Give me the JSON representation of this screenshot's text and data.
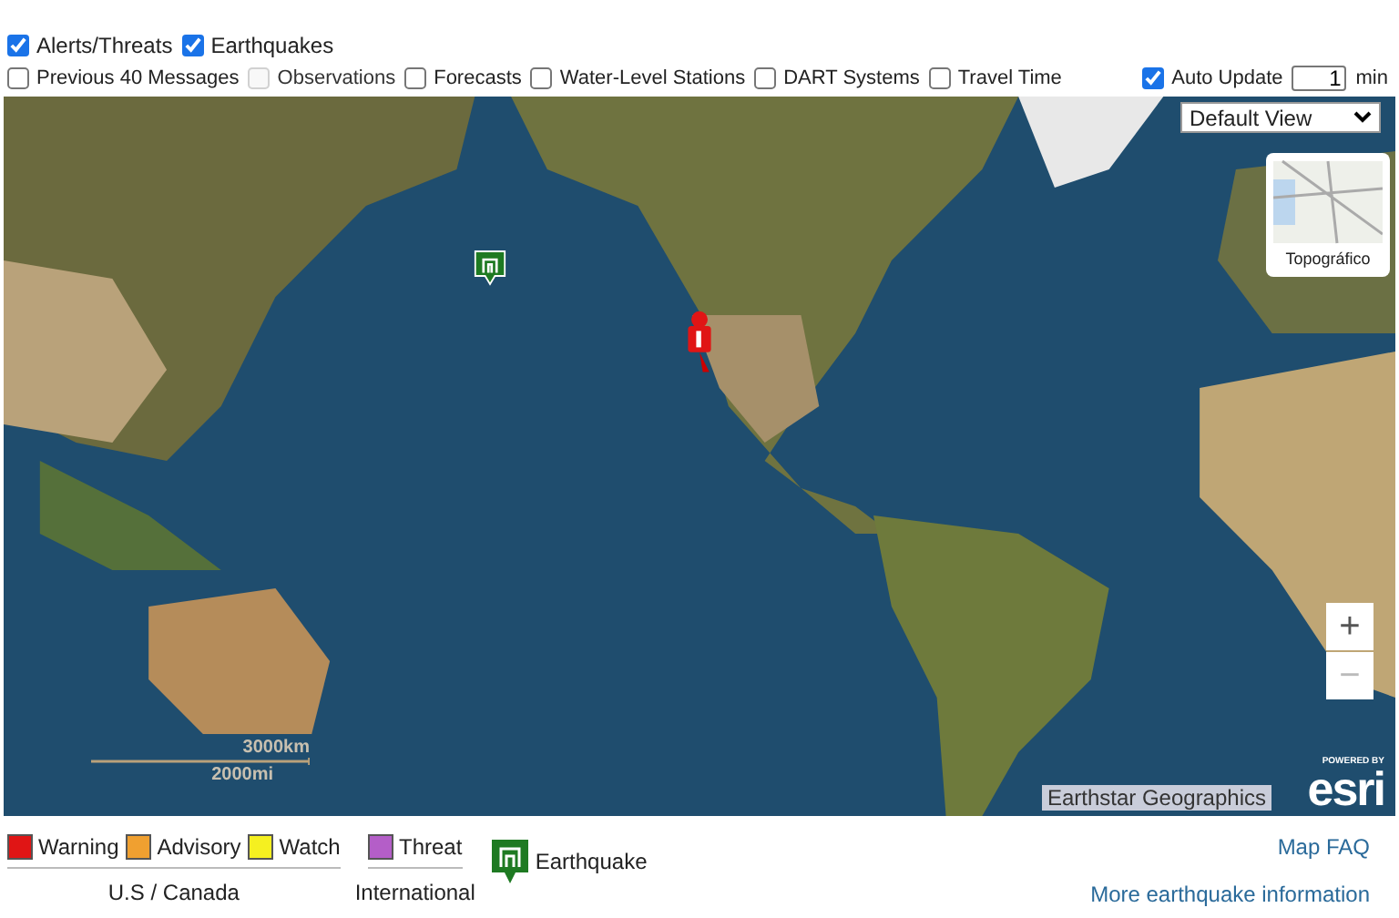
{
  "filters_top": [
    {
      "label": "Alerts/Threats",
      "checked": true,
      "disabled": false
    },
    {
      "label": "Earthquakes",
      "checked": true,
      "disabled": false
    }
  ],
  "filters": [
    {
      "label": "Previous 40 Messages",
      "checked": false,
      "disabled": false
    },
    {
      "label": "Observations",
      "checked": false,
      "disabled": true
    },
    {
      "label": "Forecasts",
      "checked": false,
      "disabled": false
    },
    {
      "label": "Water-Level Stations",
      "checked": false,
      "disabled": false
    },
    {
      "label": "DART Systems",
      "checked": false,
      "disabled": false
    },
    {
      "label": "Travel Time",
      "checked": false,
      "disabled": false
    }
  ],
  "auto_update": {
    "label": "Auto Update",
    "checked": true,
    "value": "1",
    "unit": "min"
  },
  "map": {
    "view_select": "Default View",
    "basemap_label": "Topográfico",
    "scale": [
      "3000km",
      "2000mi"
    ],
    "attribution": "Earthstar Geographics",
    "powered_by": "POWERED BY",
    "logo": "esri",
    "zoom_buttons": [
      "+",
      "−"
    ]
  },
  "legend": {
    "groups": [
      {
        "caption": "U.S / Canada",
        "items": [
          {
            "label": "Warning",
            "color": "#e01515"
          },
          {
            "label": "Advisory",
            "color": "#f0a030"
          },
          {
            "label": "Watch",
            "color": "#f5f020"
          }
        ]
      },
      {
        "caption": "International",
        "items": [
          {
            "label": "Threat",
            "color": "#b45ec8"
          }
        ]
      }
    ],
    "earthquake": "Earthquake"
  },
  "links": [
    "Map FAQ",
    "More earthquake information"
  ]
}
